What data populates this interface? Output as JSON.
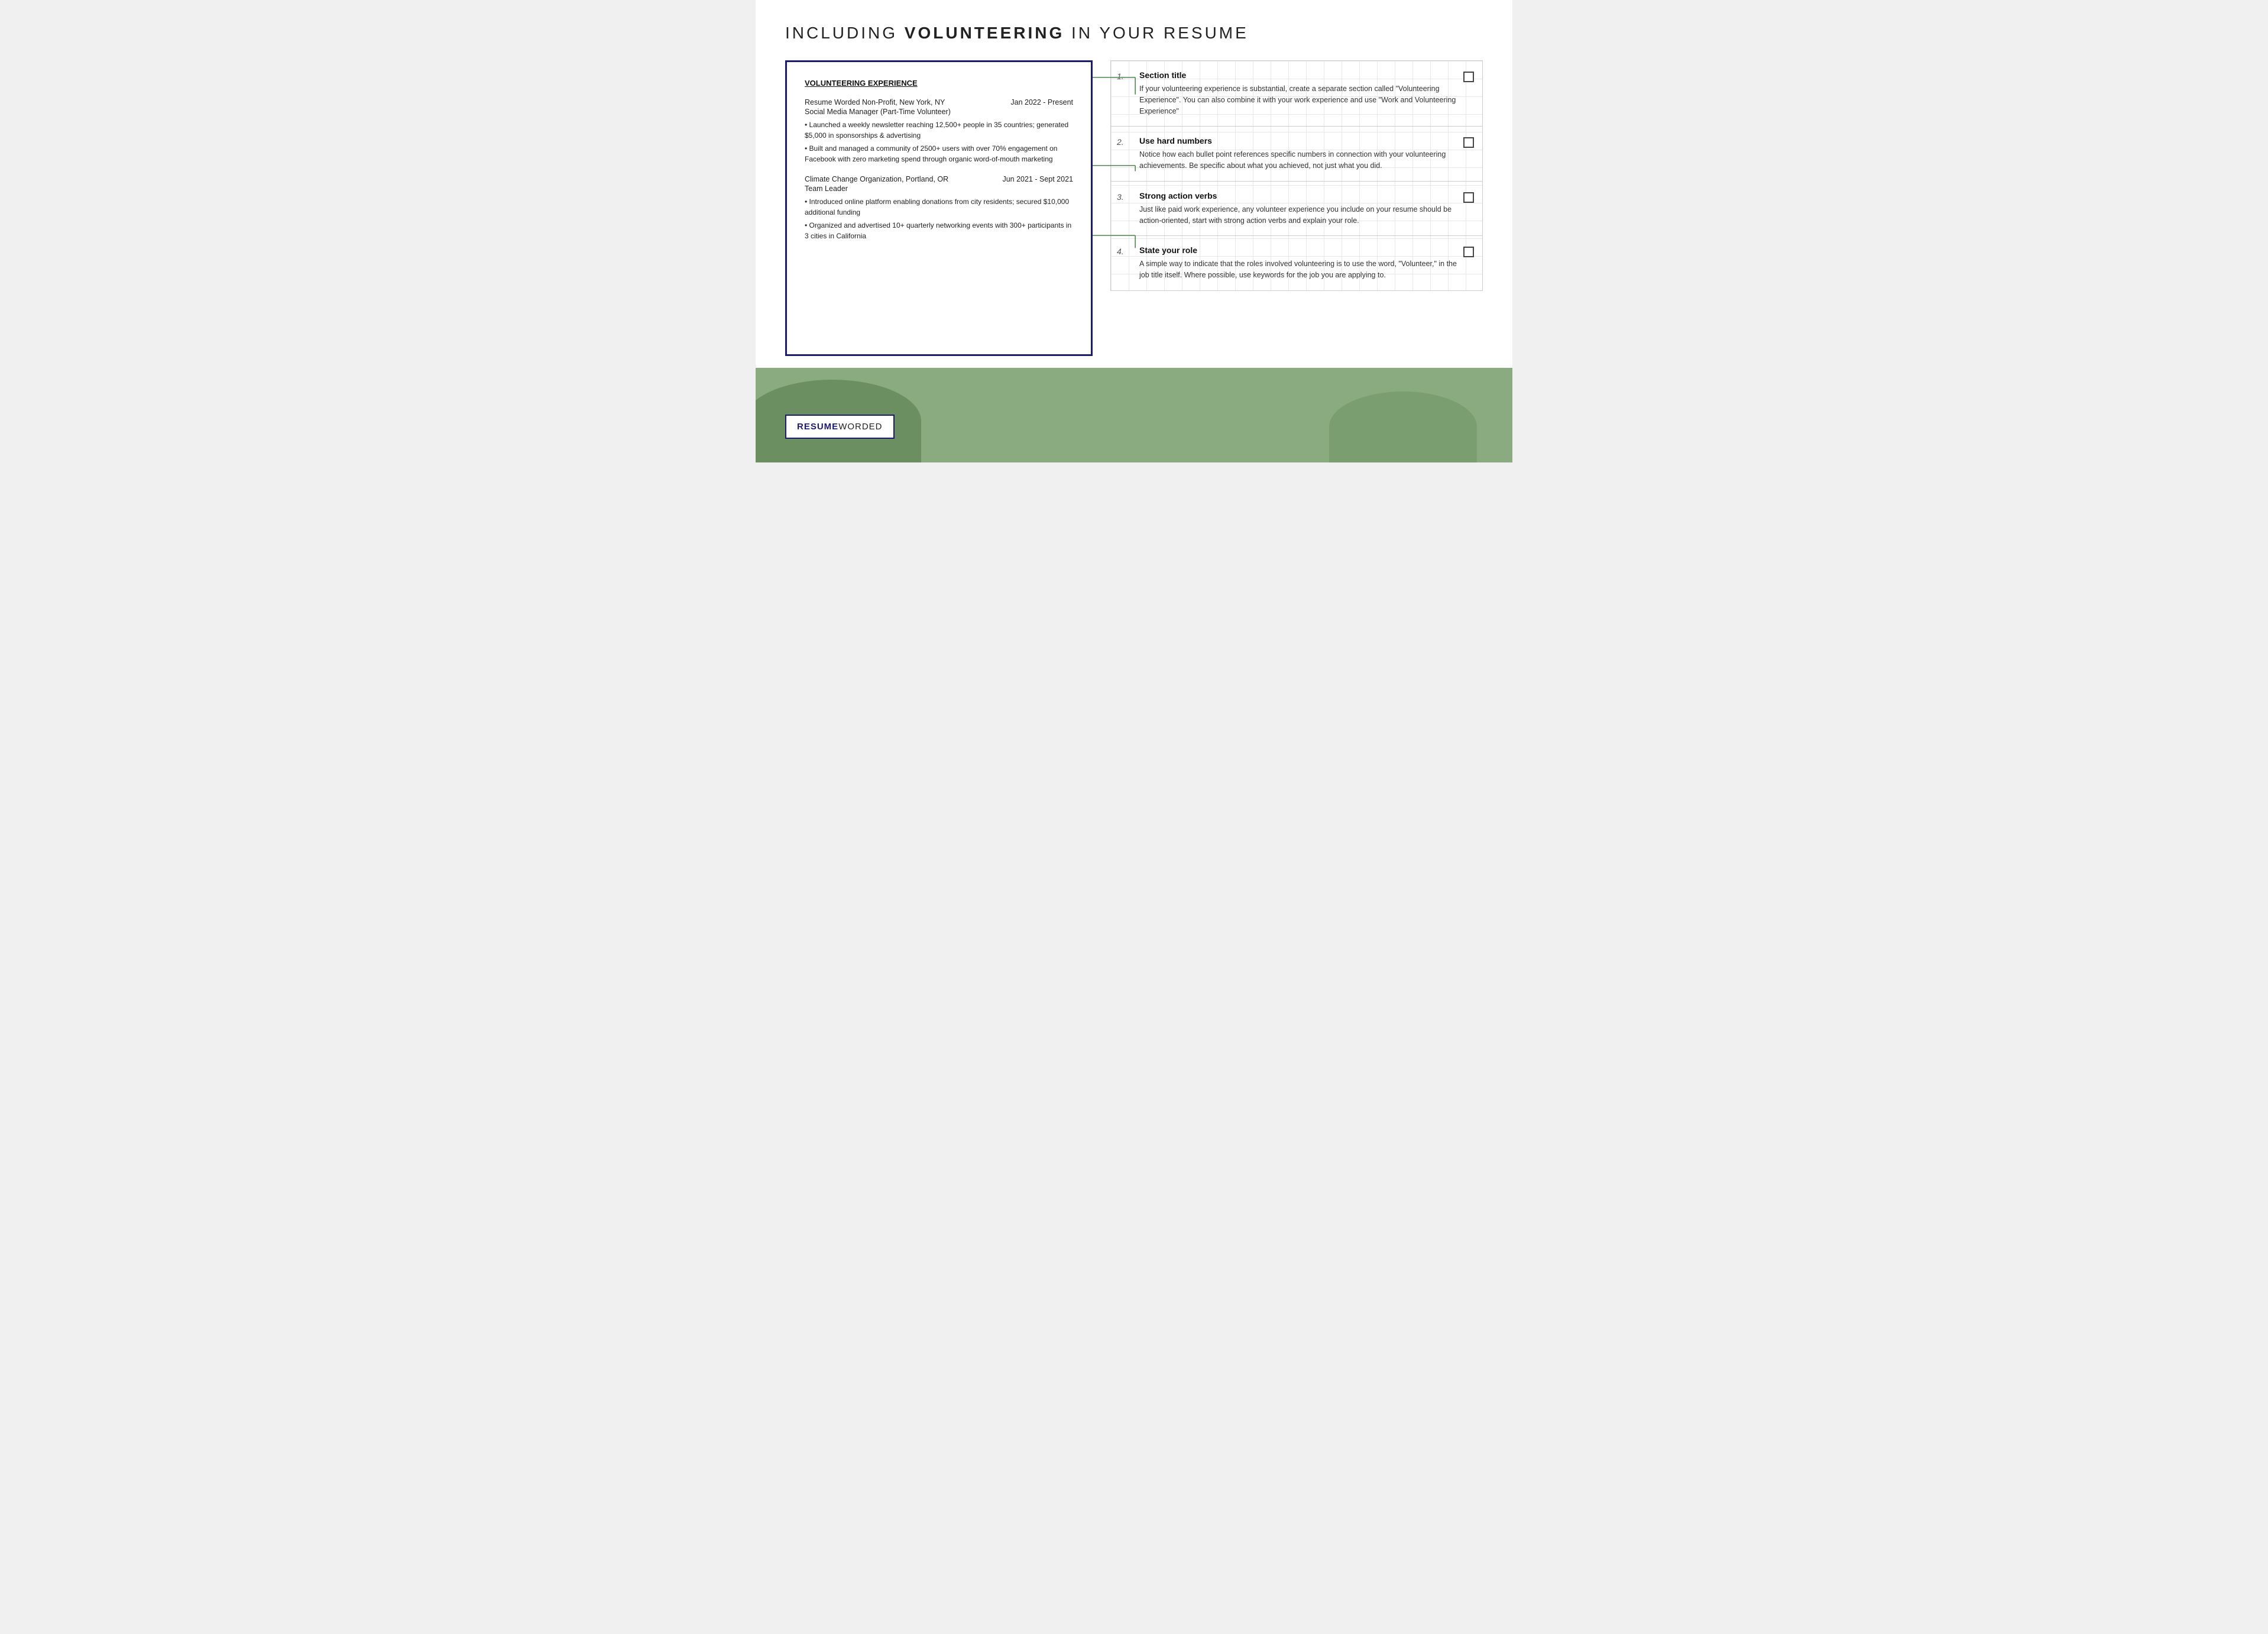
{
  "page": {
    "title_plain": "INCLUDING ",
    "title_bold": "VOLUNTEERING",
    "title_suffix": " IN YOUR RESUME",
    "background_color": "#f5f5f0"
  },
  "resume": {
    "section_title": "VOLUNTEERING EXPERIENCE",
    "entries": [
      {
        "org": "Resume Worded Non-Profit, New York, NY",
        "date": "Jan 2022 - Present",
        "role": "Social Media Manager (Part-Time Volunteer)",
        "bullets": [
          "• Launched a weekly newsletter reaching 12,500+ people in 35 countries; generated $5,000 in sponsorships & advertising",
          "• Built and managed a community of 2500+ users with over 70% engagement on Facebook with zero marketing spend through organic word-of-mouth marketing"
        ]
      },
      {
        "org": "Climate Change Organization, Portland, OR",
        "date": "Jun 2021 - Sept 2021",
        "role": "Team Leader",
        "bullets": [
          "• Introduced online platform enabling donations from city residents; secured $10,000 additional funding",
          "• Organized and advertised 10+ quarterly networking events with 300+ participants in 3 cities in California"
        ]
      }
    ]
  },
  "tips": [
    {
      "number": "1.",
      "title": "Section title",
      "description": "If your volunteering experience is substantial, create a separate section called \"Volunteering Experience\". You can also combine it with your work experience and use \"Work and Volunteering Experience\""
    },
    {
      "number": "2.",
      "title": "Use hard numbers",
      "description": "Notice how each bullet point references specific numbers in connection with your volunteering achievements. Be specific about what you achieved, not just what you did."
    },
    {
      "number": "3.",
      "title": "Strong action verbs",
      "description": "Just like paid work experience, any volunteer experience you include on your resume should be action-oriented, start with strong action verbs and explain your role."
    },
    {
      "number": "4.",
      "title": "State your role",
      "description": "A simple way to indicate that the roles involved volunteering is to use the word, \"Volunteer,\" in the job title itself. Where possible, use keywords for the job you are applying to."
    }
  ],
  "logo": {
    "resume": "RESUME",
    "worded": " WORDED"
  },
  "colors": {
    "navy": "#1a1a6e",
    "green_line": "#4a8a4a",
    "green_hill": "#8aaa80",
    "green_hill_dark": "#6b8f60"
  }
}
